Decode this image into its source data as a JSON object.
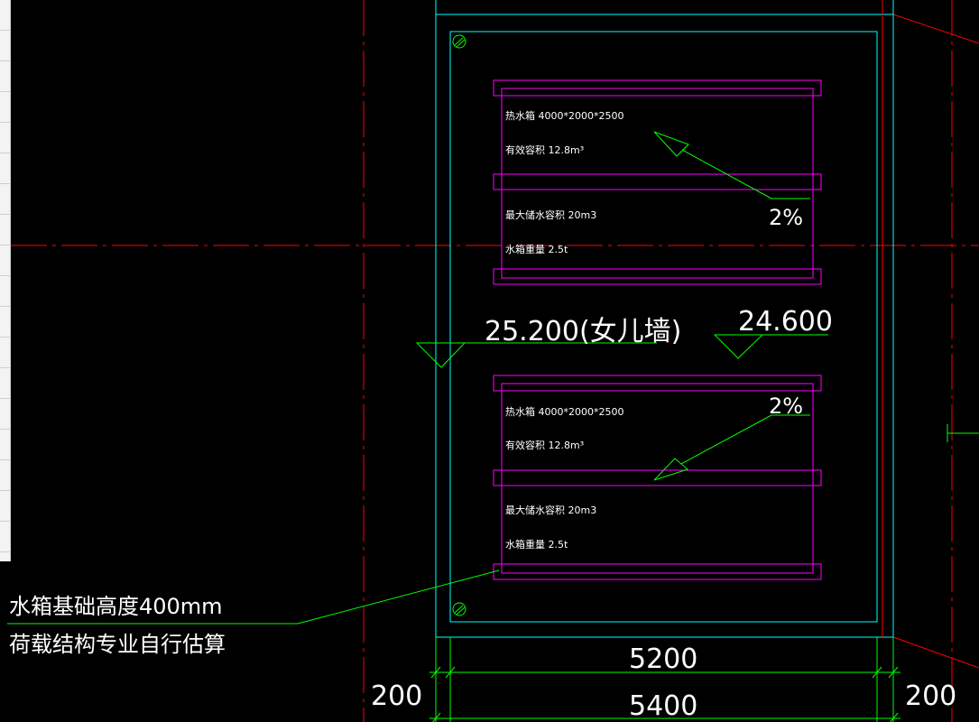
{
  "colors": {
    "background": "#000000",
    "axis_red": "#ff0000",
    "wall_cyan": "#00ffff",
    "tank_magenta": "#ff00ff",
    "leader_green": "#00ff00",
    "text_white": "#ffffff"
  },
  "tank_upper": {
    "size_label": "热水箱 4000*2000*2500",
    "volume_label": "有效容积 12.8m³",
    "max_volume_label": "最大储水容积 20m3",
    "weight_label": "水箱重量 2.5t",
    "slope_label": "2%"
  },
  "tank_lower": {
    "size_label": "热水箱 4000*2000*2500",
    "volume_label": "有效容积 12.8m³",
    "max_volume_label": "最大储水容积 20m3",
    "weight_label": "水箱重量 2.5t",
    "slope_label": "2%"
  },
  "elevations": {
    "parapet": "25.200(女儿墙)",
    "roof": "24.600"
  },
  "note": {
    "line1": "水箱基础高度400mm",
    "line2": "荷载结构专业自行估算"
  },
  "dimensions": {
    "inner": "5200",
    "outer": "5400",
    "left_wall": "200",
    "right_wall": "200"
  }
}
